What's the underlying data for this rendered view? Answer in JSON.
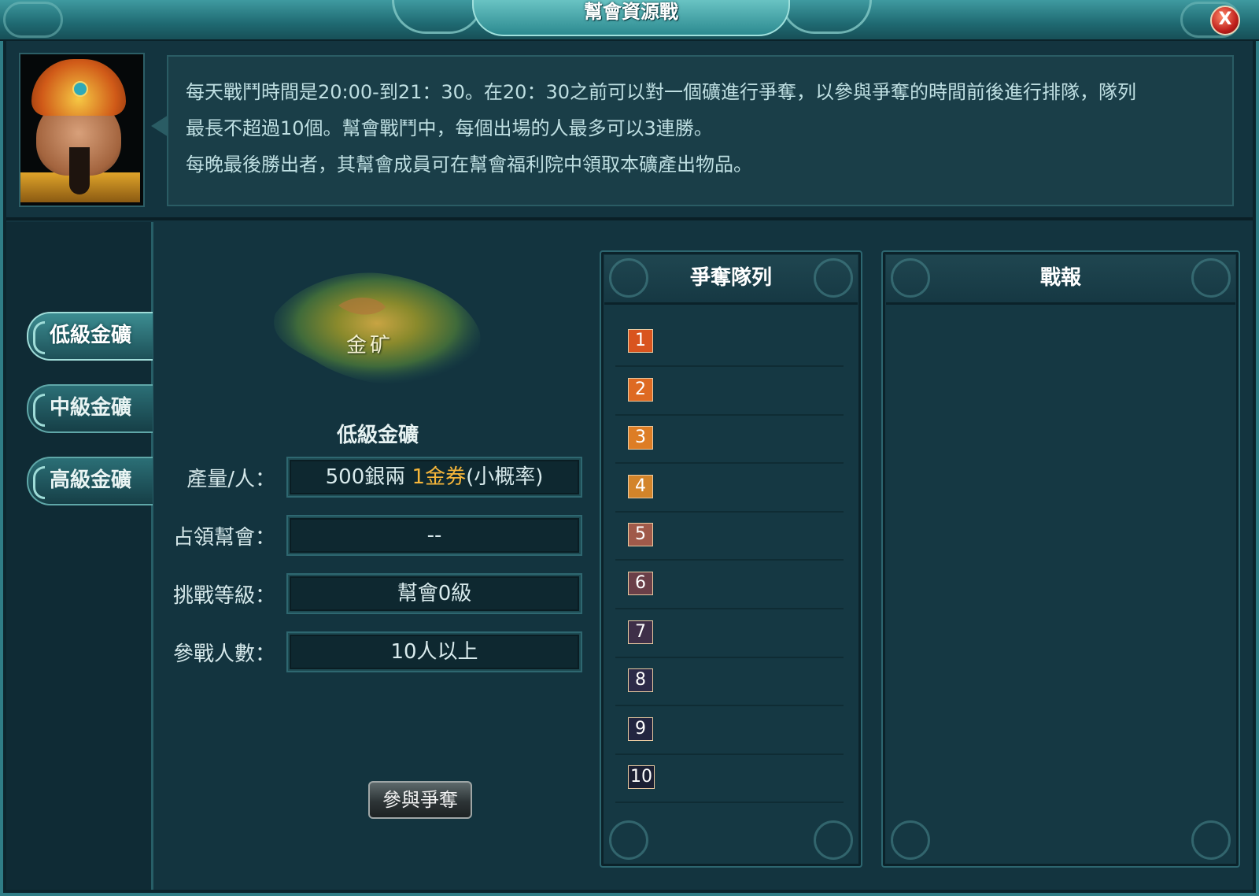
{
  "window": {
    "title": "幫會資源戰",
    "close_label": "X"
  },
  "intro": {
    "lines": [
      "每天戰鬥時間是20:00-到21：30。在20：30之前可以對一個礦進行爭奪，以參與爭奪的時間前後進行排隊，隊列",
      "最長不超過10個。幫會戰鬥中，每個出場的人最多可以3連勝。",
      "每晚最後勝出者，其幫會成員可在幫會福利院中領取本礦產出物品。"
    ]
  },
  "tabs": [
    {
      "label": "低級金礦",
      "active": true
    },
    {
      "label": "中級金礦",
      "active": false
    },
    {
      "label": "高級金礦",
      "active": false
    }
  ],
  "mine": {
    "map_label": "金矿",
    "title": "低級金礦",
    "fields": {
      "output": {
        "label": "產量/人：",
        "value_silver": "500銀兩",
        "value_gold": "1金券",
        "value_note": "(小概率)"
      },
      "occupier": {
        "label": "占領幫會：",
        "value": "--"
      },
      "level": {
        "label": "挑戰等級：",
        "value": "幫會0級"
      },
      "players": {
        "label": "參戰人數：",
        "value": "10人以上"
      }
    },
    "join_button": "參與爭奪"
  },
  "queue": {
    "title": "爭奪隊列",
    "slots": [
      "1",
      "2",
      "3",
      "4",
      "5",
      "6",
      "7",
      "8",
      "9",
      "10"
    ],
    "slot_colors": [
      "#d9541e",
      "#de6a22",
      "#dd7d25",
      "#d3842a",
      "#a05a4a",
      "#6a3f48",
      "#3e2f48",
      "#2c2a48",
      "#222540",
      "#1b1f33"
    ]
  },
  "report": {
    "title": "戰報"
  },
  "colors": {
    "accent": "#2f7d86",
    "gold_text": "#f6b63a"
  }
}
